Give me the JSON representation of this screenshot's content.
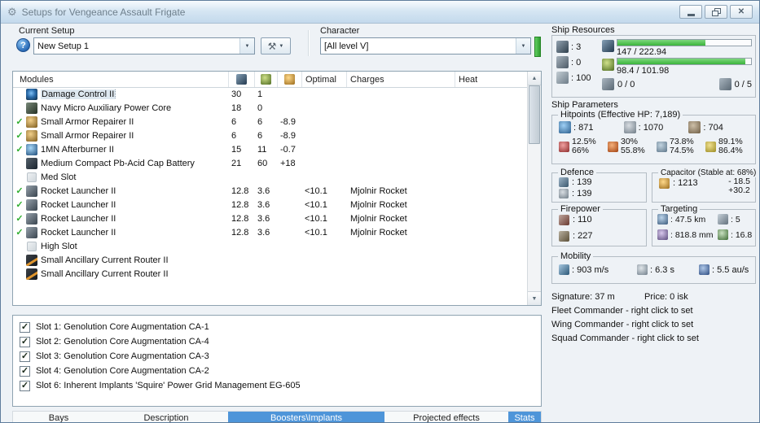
{
  "colors": {
    "bar_green": "#3bb53b",
    "tab_active": "#4e95d9",
    "check_green": "#2fae2f"
  },
  "window": {
    "title": "Setups for Vengeance Assault Frigate"
  },
  "setup_bar": {
    "current_setup_label": "Current Setup",
    "setup_value": "New Setup 1",
    "character_label": "Character",
    "character_value": "[All level V]"
  },
  "modules_table": {
    "header": {
      "modules": "Modules",
      "optimal": "Optimal",
      "charges": "Charges",
      "heat": "Heat"
    },
    "rows": [
      {
        "checked": false,
        "selected": true,
        "icon": "damage-control",
        "name": "Damage Control II",
        "cpu": "30",
        "pg": "1",
        "cap": "",
        "optimal": "",
        "charges": ""
      },
      {
        "checked": false,
        "selected": false,
        "icon": "power-core",
        "name": "Navy Micro Auxiliary Power Core",
        "cpu": "18",
        "pg": "0",
        "cap": "",
        "optimal": "",
        "charges": ""
      },
      {
        "checked": true,
        "selected": false,
        "icon": "armor-repairer",
        "name": "Small Armor Repairer II",
        "cpu": "6",
        "pg": "6",
        "cap": "-8.9",
        "optimal": "",
        "charges": ""
      },
      {
        "checked": true,
        "selected": false,
        "icon": "armor-repairer",
        "name": "Small Armor Repairer II",
        "cpu": "6",
        "pg": "6",
        "cap": "-8.9",
        "optimal": "",
        "charges": ""
      },
      {
        "checked": true,
        "selected": false,
        "icon": "afterburner",
        "name": "1MN Afterburner II",
        "cpu": "15",
        "pg": "11",
        "cap": "-0.7",
        "optimal": "",
        "charges": ""
      },
      {
        "checked": false,
        "selected": false,
        "icon": "cap-battery",
        "name": "Medium Compact Pb-Acid Cap Battery",
        "cpu": "21",
        "pg": "60",
        "cap": "+18",
        "optimal": "",
        "charges": ""
      },
      {
        "checked": false,
        "selected": false,
        "icon": "empty-med-slot",
        "name": "Med Slot",
        "cpu": "",
        "pg": "",
        "cap": "",
        "optimal": "",
        "charges": ""
      },
      {
        "checked": true,
        "selected": false,
        "icon": "rocket-launcher",
        "name": "Rocket Launcher II",
        "cpu": "12.8",
        "pg": "3.6",
        "cap": "",
        "optimal": "<10.1",
        "charges": "Mjolnir Rocket"
      },
      {
        "checked": true,
        "selected": false,
        "icon": "rocket-launcher",
        "name": "Rocket Launcher II",
        "cpu": "12.8",
        "pg": "3.6",
        "cap": "",
        "optimal": "<10.1",
        "charges": "Mjolnir Rocket"
      },
      {
        "checked": true,
        "selected": false,
        "icon": "rocket-launcher",
        "name": "Rocket Launcher II",
        "cpu": "12.8",
        "pg": "3.6",
        "cap": "",
        "optimal": "<10.1",
        "charges": "Mjolnir Rocket"
      },
      {
        "checked": true,
        "selected": false,
        "icon": "rocket-launcher",
        "name": "Rocket Launcher II",
        "cpu": "12.8",
        "pg": "3.6",
        "cap": "",
        "optimal": "<10.1",
        "charges": "Mjolnir Rocket"
      },
      {
        "checked": false,
        "selected": false,
        "icon": "empty-high-slot",
        "name": "High Slot",
        "cpu": "",
        "pg": "",
        "cap": "",
        "optimal": "",
        "charges": ""
      },
      {
        "checked": false,
        "selected": false,
        "icon": "rig",
        "name": "Small Ancillary Current Router II",
        "cpu": "",
        "pg": "",
        "cap": "",
        "optimal": "",
        "charges": ""
      },
      {
        "checked": false,
        "selected": false,
        "icon": "rig",
        "name": "Small Ancillary Current Router II",
        "cpu": "",
        "pg": "",
        "cap": "",
        "optimal": "",
        "charges": ""
      }
    ]
  },
  "implants_panel": {
    "items": [
      "Slot 1: Genolution Core Augmentation CA-1",
      "Slot 2: Genolution Core Augmentation CA-4",
      "Slot 3: Genolution Core Augmentation CA-3",
      "Slot 4: Genolution Core Augmentation CA-2",
      "Slot 6: Inherent Implants 'Squire' Power Grid Management EG-605"
    ]
  },
  "tabs": [
    {
      "label": "Bays",
      "active": false
    },
    {
      "label": "Description",
      "active": false
    },
    {
      "label": "Boosters\\Implants",
      "active": true
    },
    {
      "label": "Projected effects",
      "active": false
    },
    {
      "label": "Stats",
      "active": true
    }
  ],
  "ship_resources": {
    "label": "Ship Resources",
    "hardpoints": {
      "turrets": ": 3",
      "launchers": ": 0",
      "calibration": ": 100"
    },
    "cpu": {
      "text": "147 / 222.94",
      "pct": 66
    },
    "powergrid": {
      "text": "98.4 / 101.98",
      "pct": 96
    },
    "drones": {
      "bay": "0 / 0",
      "bandwidth": "0 / 5"
    }
  },
  "ship_parameters": {
    "label": "Ship Parameters",
    "hitpoints": {
      "label": "Hitpoints (Effective HP: 7,189)",
      "shield": ": 871",
      "armor": ": 1070",
      "structure": ": 704",
      "resists": [
        {
          "type": "em",
          "shield": "12.5%",
          "armor": "66%"
        },
        {
          "type": "thermal",
          "shield": "30%",
          "armor": "55.8%"
        },
        {
          "type": "kinetic",
          "shield": "73.8%",
          "armor": "74.5%"
        },
        {
          "type": "explosive",
          "shield": "89.1%",
          "armor": "86.4%"
        }
      ]
    },
    "defence": {
      "label": "Defence",
      "value1": ": 139",
      "value2": ": 139"
    },
    "capacitor": {
      "label": "Capacitor (Stable at: 68%)",
      "amount": ": 1213",
      "drain": "- 18.5",
      "recharge": "+30.2"
    },
    "firepower": {
      "label": "Firepower",
      "dps": ": 110",
      "volley": ": 227"
    },
    "targeting": {
      "label": "Targeting",
      "range": ": 47.5 km",
      "max_targets": ": 5",
      "scan_resolution": ": 818.8 mm",
      "sensor_strength": ": 16.8"
    },
    "mobility": {
      "label": "Mobility",
      "speed": ": 903 m/s",
      "align_time": ": 6.3 s",
      "warp_speed": ": 5.5 au/s"
    },
    "signature": "Signature: 37 m",
    "price": "Price: 0 isk",
    "fleet_commander": "Fleet Commander - right click to set",
    "wing_commander": "Wing Commander - right click to set",
    "squad_commander": "Squad Commander - right click to set"
  }
}
